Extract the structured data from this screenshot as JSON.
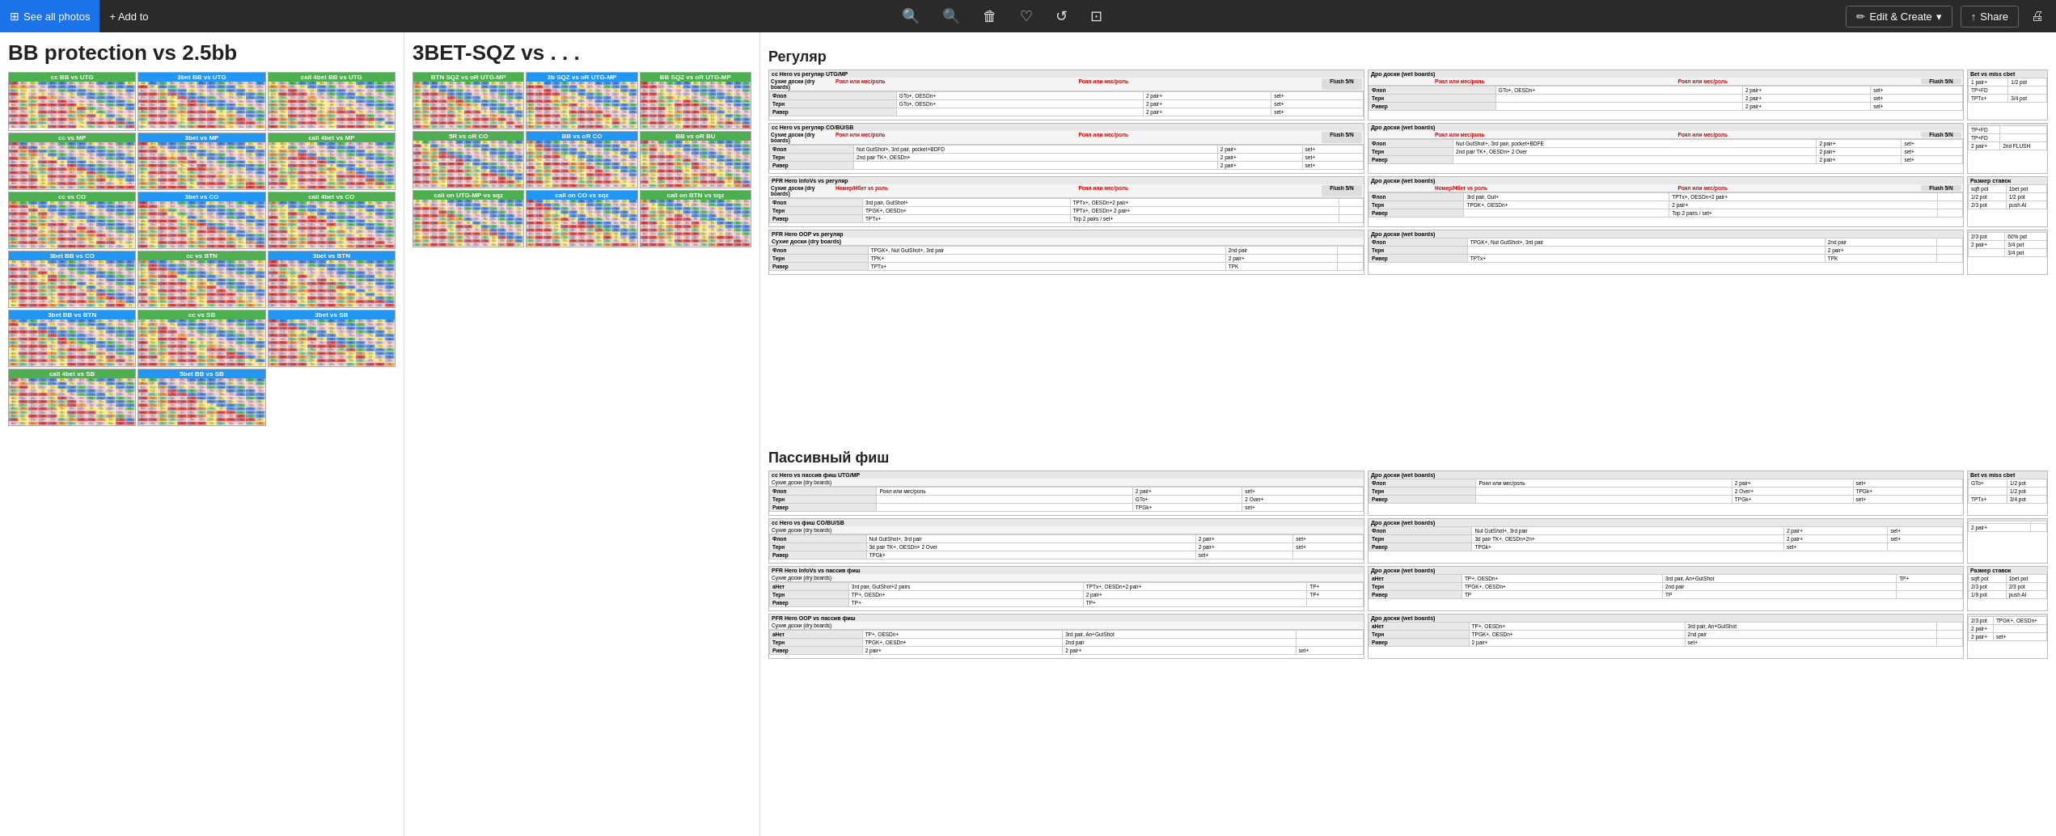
{
  "toolbar": {
    "see_all_photos": "See all photos",
    "add_to": "+ Add to",
    "edit_create": "Edit & Create",
    "share": "Share",
    "zoom_in_title": "Zoom in",
    "zoom_out_title": "Zoom out",
    "delete_title": "Delete",
    "favorite_title": "Favorite",
    "rotate_title": "Rotate",
    "crop_title": "Crop"
  },
  "panels": {
    "left": {
      "title": "BB protection vs 2.5bb",
      "matrices": [
        {
          "label": "cc BB vs UTG",
          "pct": ""
        },
        {
          "label": "3bet BB vs UTG",
          "pct": ""
        },
        {
          "label": "call 4bet BB vs UTG",
          "pct": ""
        }
      ]
    },
    "center": {
      "title": "3BET-SQZ vs . . .",
      "sections": [
        {
          "label": "BTN SQZ vs oR UTG-MP"
        },
        {
          "label": "3b SQZ vs oR UTG-MP"
        },
        {
          "label": "BB SQZ vs oR UTG-MP"
        }
      ]
    },
    "right": {
      "sections": [
        {
          "title": "Регуляр",
          "subsections": [
            {
              "name": "сс Hero vs регуляр UTG/MP",
              "dry_boards_label": "Сухие доски (dry boards)",
              "wet_boards_label": "Дро доски (wet boards)",
              "flush_label": "Flush 5/N",
              "columns_dry": [
                "Роял или мес/роль",
                "Роял или мес/роль",
                ""
              ],
              "columns_wet": [
                "Роял или мес/роль",
                "Роял или мес/роль",
                ""
              ],
              "rows": [
                {
                  "name": "Флоп",
                  "d1": "GTo+, OESDn+",
                  "d2": "2 pair+",
                  "d3": "set+",
                  "w1": "GTo+, OESDn+",
                  "w2": "2 pair+",
                  "w3": "set+",
                  "r1": "1 pair+",
                  "r2": "1/2 pot"
                },
                {
                  "name": "Терн",
                  "d1": "",
                  "d2": "2 pair+",
                  "d3": "set+",
                  "w1": "",
                  "w2": "2 pair+",
                  "w3": "set+",
                  "r1": "TP+FD",
                  "r2": ""
                },
                {
                  "name": "Ривер",
                  "d1": "",
                  "d2": "2 pair+",
                  "d3": "set+",
                  "w1": "",
                  "w2": "2 pair+",
                  "w3": "set+",
                  "r1": "TPTx+",
                  "r2": "3/4 pot"
                }
              ]
            }
          ]
        },
        {
          "title": "Пассивный фиш",
          "subsections": []
        }
      ]
    }
  }
}
